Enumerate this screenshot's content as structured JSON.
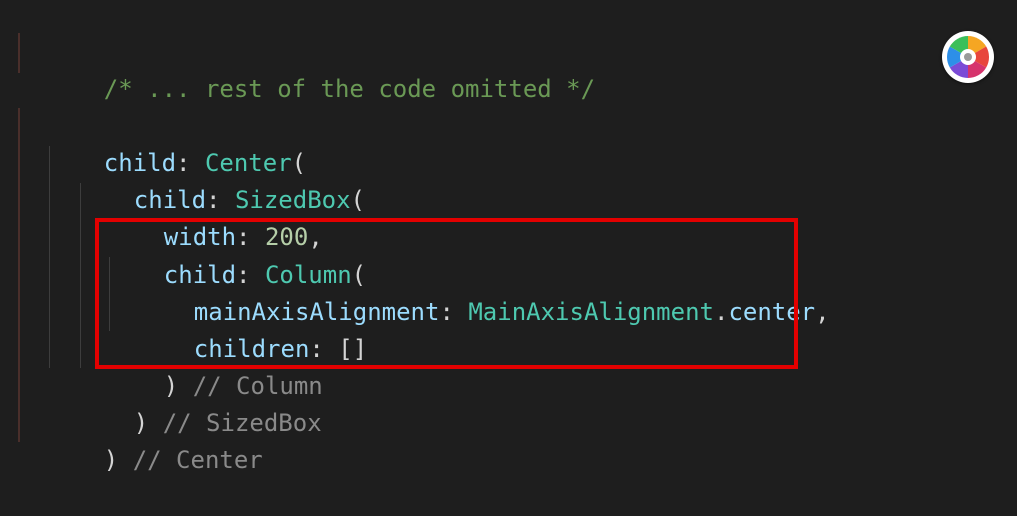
{
  "code": {
    "comment_top": "/* ... rest of the code omitted */",
    "line_center": {
      "prop": "child",
      "colon": ": ",
      "class": "Center",
      "open": "("
    },
    "line_sizedbox": {
      "prop": "child",
      "colon": ": ",
      "class": "SizedBox",
      "open": "("
    },
    "line_width": {
      "prop": "width",
      "colon": ": ",
      "value": "200",
      "comma": ","
    },
    "line_column": {
      "prop": "child",
      "colon": ": ",
      "class": "Column",
      "open": "("
    },
    "line_main_axis": {
      "prop": "mainAxisAlignment",
      "colon": ": ",
      "class": "MainAxisAlignment",
      "dot": ".",
      "member": "center",
      "comma": ","
    },
    "line_children": {
      "prop": "children",
      "colon": ": ",
      "value": "[]"
    },
    "line_close_column": {
      "paren": ")",
      "comment": " // Column"
    },
    "line_close_sizedbox": {
      "paren": ")",
      "comment": " // SizedBox"
    },
    "line_close_center": {
      "paren": ")",
      "comment": " // Center"
    }
  },
  "colors": {
    "background": "#1e1e1e",
    "comment": "#6a9955",
    "property": "#9cdcfe",
    "class": "#4ec9b0",
    "number": "#b5cea8",
    "highlight_border": "#e30000"
  },
  "icons": {
    "color_wheel": "color-wheel-icon"
  }
}
